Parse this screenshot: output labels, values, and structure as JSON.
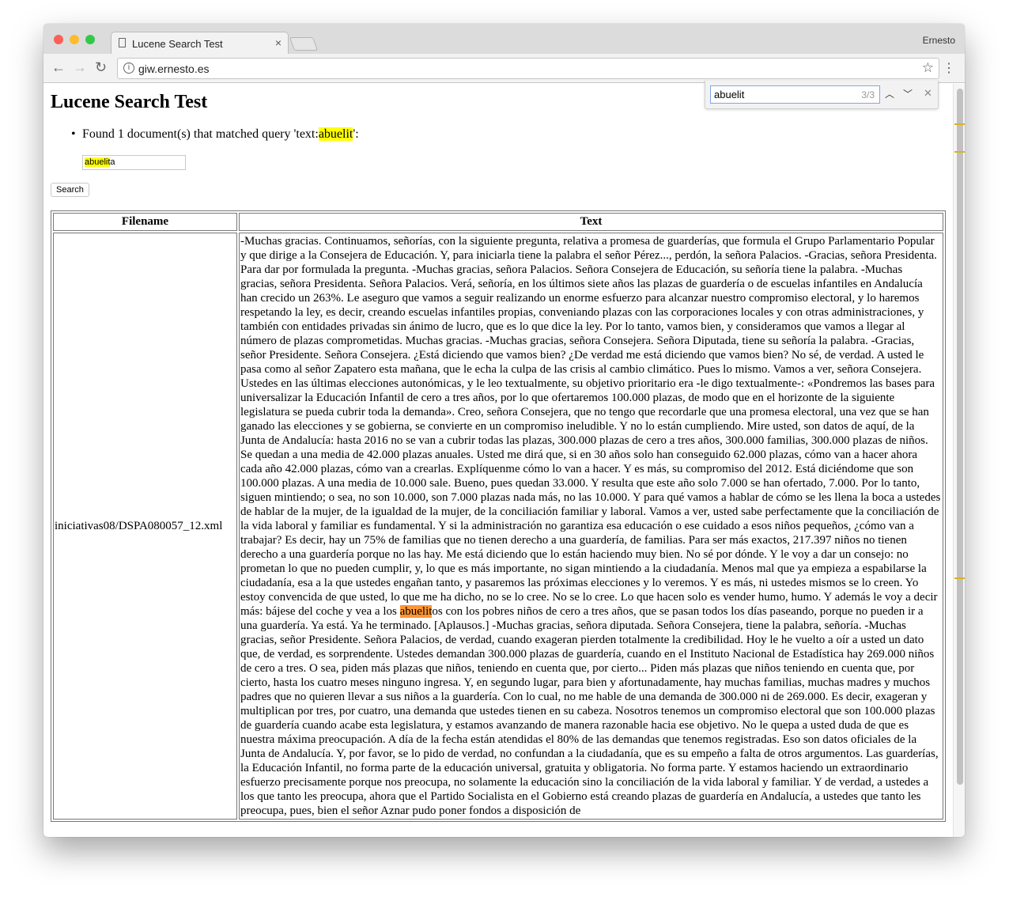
{
  "browser": {
    "tab_title": "Lucene Search Test",
    "profile": "Ernesto",
    "url": "giw.ernesto.es"
  },
  "find_bar": {
    "query": "abuelit",
    "count": "3/3"
  },
  "page": {
    "title": "Lucene Search Test",
    "result_prefix": "Found 1 document(s) that matched query 'text:",
    "result_term": "abuelit",
    "result_suffix": "':",
    "search_input_match": "abuelit",
    "search_input_rest": "a",
    "search_button": "Search",
    "table": {
      "headers": [
        "Filename",
        "Text"
      ],
      "rows": [
        {
          "filename": "iniciativas08/DSPA080057_12.xml",
          "text_before": "-Muchas gracias. Continuamos, señorías, con la siguiente pregunta, relativa a promesa de guarderías, que formula el Grupo Parlamentario Popular y que dirige a la Consejera de Educación. Y, para iniciarla tiene la palabra el señor Pérez..., perdón, la señora Palacios. -Gracias, señora Presidenta. Para dar por formulada la pregunta. -Muchas gracias, señora Palacios. Señora Consejera de Educación, su señoría tiene la palabra. -Muchas gracias, señora Presidenta. Señora Palacios. Verá, señoría, en los últimos siete años las plazas de guardería o de escuelas infantiles en Andalucía han crecido un 263%. Le aseguro que vamos a seguir realizando un enorme esfuerzo para alcanzar nuestro compromiso electoral, y lo haremos respetando la ley, es decir, creando escuelas infantiles propias, conveniando plazas con las corporaciones locales y con otras administraciones, y también con entidades privadas sin ánimo de lucro, que es lo que dice la ley. Por lo tanto, vamos bien, y consideramos que vamos a llegar al número de plazas comprometidas. Muchas gracias. -Muchas gracias, señora Consejera. Señora Diputada, tiene su señoría la palabra. -Gracias, señor Presidente. Señora Consejera. ¿Está diciendo que vamos bien? ¿De verdad me está diciendo que vamos bien? No sé, de verdad. A usted le pasa como al señor Zapatero esta mañana, que le echa la culpa de las crisis al cambio climático. Pues lo mismo. Vamos a ver, señora Consejera. Ustedes en las últimas elecciones autonómicas, y le leo textualmente, su objetivo prioritario era -le digo textualmente-: «Pondremos las bases para universalizar la Educación Infantil de cero a tres años, por lo que ofertaremos 100.000 plazas, de modo que en el horizonte de la siguiente legislatura se pueda cubrir toda la demanda». Creo, señora Consejera, que no tengo que recordarle que una promesa electoral, una vez que se han ganado las elecciones y se gobierna, se convierte en un compromiso ineludible. Y no lo están cumpliendo. Mire usted, son datos de aquí, de la Junta de Andalucía: hasta 2016 no se van a cubrir todas las plazas, 300.000 plazas de cero a tres años, 300.000 familias, 300.000 plazas de niños. Se quedan a una media de 42.000 plazas anuales. Usted me dirá que, si en 30 años solo han conseguido 62.000 plazas, cómo van a hacer ahora cada año 42.000 plazas, cómo van a crearlas. Explíquenme cómo lo van a hacer. Y es más, su compromiso del 2012. Está diciéndome que son 100.000 plazas. A una media de 10.000 sale. Bueno, pues quedan 33.000. Y resulta que este año solo 7.000 se han ofertado, 7.000. Por lo tanto, siguen mintiendo; o sea, no son 10.000, son 7.000 plazas nada más, no las 10.000. Y para qué vamos a hablar de cómo se les llena la boca a ustedes de hablar de la mujer, de la igualdad de la mujer, de la conciliación familiar y laboral. Vamos a ver, usted sabe perfectamente que la conciliación de la vida laboral y familiar es fundamental. Y si la administración no garantiza esa educación o ese cuidado a esos niños pequeños, ¿cómo van a trabajar? Es decir, hay un 75% de familias que no tienen derecho a una guardería, de familias. Para ser más exactos, 217.397 niños no tienen derecho a una guardería porque no las hay. Me está diciendo que lo están haciendo muy bien. No sé por dónde. Y le voy a dar un consejo: no prometan lo que no pueden cumplir, y, lo que es más importante, no sigan mintiendo a la ciudadanía. Menos mal que ya empieza a espabilarse la ciudadanía, esa a la que ustedes engañan tanto, y pasaremos las próximas elecciones y lo veremos. Y es más, ni ustedes mismos se lo creen. Yo estoy convencida de que usted, lo que me ha dicho, no se lo cree. No se lo cree. Lo que hacen solo es vender humo, humo. Y además le voy a decir más: bájese del coche y vea a los ",
          "text_match": "abuelit",
          "text_after": "os con los pobres niños de cero a tres años, que se pasan todos los días paseando, porque no pueden ir a una guardería. Ya está. Ya he terminado. [Aplausos.] -Muchas gracias, señora diputada. Señora Consejera, tiene la palabra, señoría. -Muchas gracias, señor Presidente. Señora Palacios, de verdad, cuando exageran pierden totalmente la credibilidad. Hoy le he vuelto a oír a usted un dato que, de verdad, es sorprendente. Ustedes demandan 300.000 plazas de guardería, cuando en el Instituto Nacional de Estadística hay 269.000 niños de cero a tres. O sea, piden más plazas que niños, teniendo en cuenta que, por cierto... Piden más plazas que niños teniendo en cuenta que, por cierto, hasta los cuatro meses ninguno ingresa. Y, en segundo lugar, para bien y afortunadamente, hay muchas familias, muchas madres y muchos padres que no quieren llevar a sus niños a la guardería. Con lo cual, no me hable de una demanda de 300.000 ni de 269.000. Es decir, exageran y multiplican por tres, por cuatro, una demanda que ustedes tienen en su cabeza. Nosotros tenemos un compromiso electoral que son 100.000 plazas de guardería cuando acabe esta legislatura, y estamos avanzando de manera razonable hacia ese objetivo. No le quepa a usted duda de que es nuestra máxima preocupación. A día de la fecha están atendidas el 80% de las demandas que tenemos registradas. Eso son datos oficiales de la Junta de Andalucía. Y, por favor, se lo pido de verdad, no confundan a la ciudadanía, que es su empeño a falta de otros argumentos. Las guarderías, la Educación Infantil, no forma parte de la educación universal, gratuita y obligatoria. No forma parte. Y estamos haciendo un extraordinario esfuerzo precisamente porque nos preocupa, no solamente la educación sino la conciliación de la vida laboral y familiar. Y de verdad, a ustedes a los que tanto les preocupa, ahora que el Partido Socialista en el Gobierno está creando plazas de guardería en Andalucía, a ustedes que tanto les preocupa, pues, bien el señor Aznar pudo poner fondos a disposición de"
        }
      ]
    }
  }
}
